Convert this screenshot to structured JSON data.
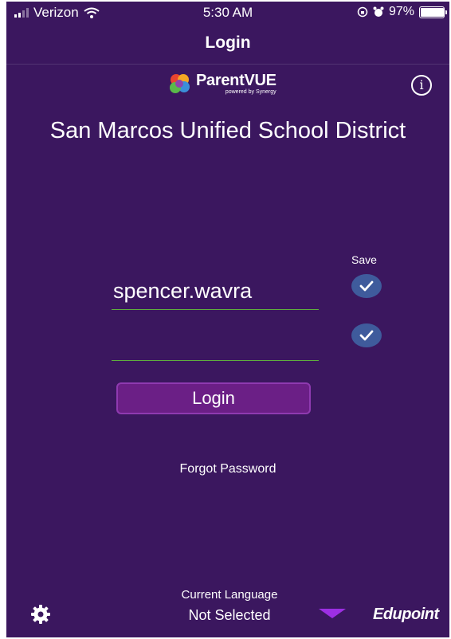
{
  "status_bar": {
    "carrier": "Verizon",
    "time": "5:30 AM",
    "battery_text": "97%",
    "battery_level": 0.97
  },
  "nav": {
    "title": "Login"
  },
  "logo": {
    "name": "ParentVUE",
    "tagline": "powered by Synergy"
  },
  "district": "San Marcos Unified School District",
  "form": {
    "save_label": "Save",
    "username_value": "spencer.wavra",
    "password_value": "",
    "save_username_checked": true,
    "save_password_checked": true,
    "login_label": "Login",
    "forgot_label": "Forgot Password"
  },
  "footer": {
    "language_label": "Current Language",
    "language_value": "Not Selected",
    "brand": "Edupoint"
  },
  "colors": {
    "background": "#3b175f",
    "login_button": "#6b1f86",
    "checkbox": "#3f5b9c",
    "field_underline": "#5fae3e",
    "dropdown_arrow": "#9d2fe3"
  },
  "icons": [
    "signal-icon",
    "wifi-icon",
    "lock-rotation-icon",
    "alarm-icon",
    "battery-icon",
    "parentvue-logo-icon",
    "info-icon",
    "checkmark-icon",
    "gear-icon",
    "dropdown-arrow-icon"
  ]
}
